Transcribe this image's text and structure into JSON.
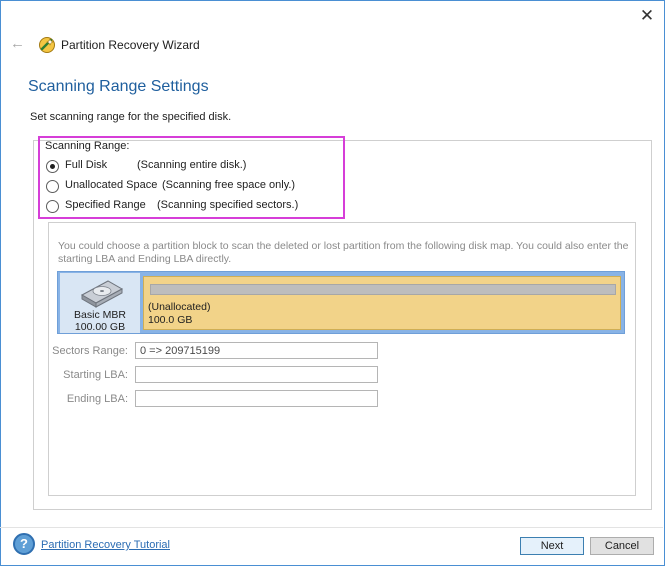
{
  "window": {
    "title": "Partition Recovery Wizard",
    "close_glyph": "✕",
    "back_glyph": "←"
  },
  "page": {
    "title": "Scanning Range Settings",
    "description": "Set scanning range for the specified disk."
  },
  "scanning_range": {
    "label": "Scanning Range:",
    "options": [
      {
        "label": "Full Disk",
        "note": "(Scanning entire disk.)",
        "selected": true
      },
      {
        "label": "Unallocated Space",
        "note": "(Scanning free space only.)",
        "selected": false
      },
      {
        "label": "Specified Range",
        "note": "(Scanning specified sectors.)",
        "selected": false
      }
    ]
  },
  "disk_map": {
    "hint": "You could choose a partition block to scan the deleted or lost partition from the following disk map. You could also enter the starting LBA and Ending LBA directly.",
    "disk": {
      "name": "Basic MBR",
      "size": "100.00 GB"
    },
    "partition": {
      "name": "(Unallocated)",
      "size": "100.0 GB"
    }
  },
  "fields": {
    "sectors_range": {
      "label": "Sectors Range:",
      "value": "0 => 209715199"
    },
    "starting_lba": {
      "label": "Starting LBA:",
      "value": ""
    },
    "ending_lba": {
      "label": "Ending LBA:",
      "value": ""
    }
  },
  "footer": {
    "help_glyph": "?",
    "tutorial_link": "Partition Recovery Tutorial",
    "next_label": "Next",
    "cancel_label": "Cancel"
  },
  "colors": {
    "title_blue": "#1f5f9e",
    "highlight_magenta": "#d63ed8",
    "disk_map_blue": "#88b3e6",
    "partition_yellow": "#f2d389",
    "link_blue": "#2b6cb3"
  },
  "icons": {
    "app": "wizard-wand-icon",
    "disk": "hard-disk-icon",
    "help": "help-circle-icon"
  }
}
